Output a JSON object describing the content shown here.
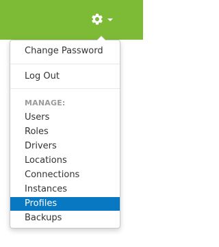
{
  "header": {
    "settings_icon": "gear-icon",
    "dropdown_icon": "caret-down-icon",
    "background_color": "#7dbb36"
  },
  "menu": {
    "change_password": "Change Password",
    "logout": "Log Out",
    "manage_heading": "MANAGE:",
    "items": [
      {
        "label": "Users"
      },
      {
        "label": "Roles"
      },
      {
        "label": "Drivers"
      },
      {
        "label": "Locations"
      },
      {
        "label": "Connections"
      },
      {
        "label": "Instances"
      },
      {
        "label": "Profiles",
        "selected": true
      },
      {
        "label": "Backups"
      }
    ],
    "selected_color": "#0878c2"
  }
}
